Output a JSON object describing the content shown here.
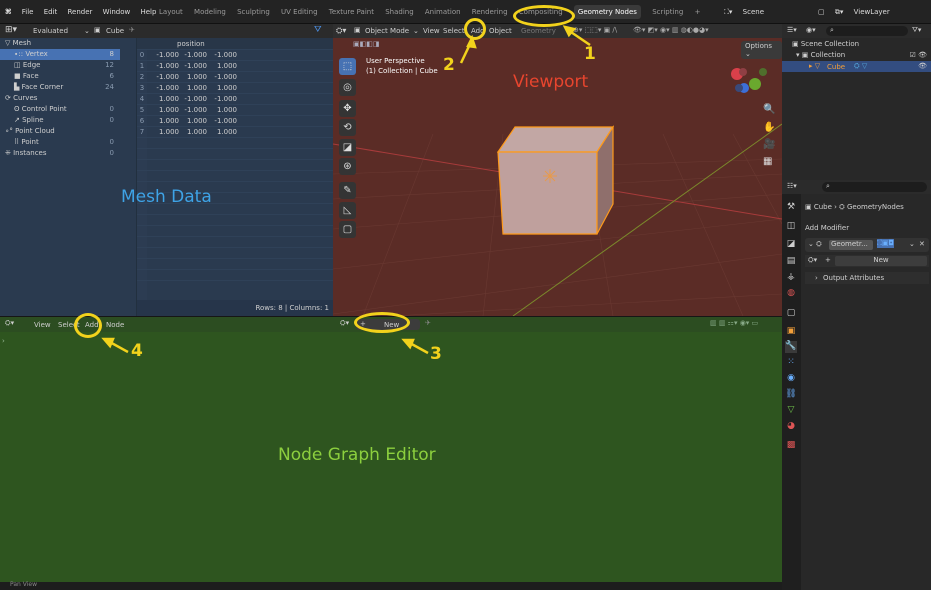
{
  "topbar": {
    "menus": [
      "File",
      "Edit",
      "Render",
      "Window",
      "Help"
    ],
    "workspaces": [
      "Layout",
      "Modeling",
      "Sculpting",
      "UV Editing",
      "Texture Paint",
      "Shading",
      "Animation",
      "Rendering",
      "Compositing",
      "Geometry Nodes",
      "Scripting",
      "+"
    ],
    "scene_label": "Scene",
    "viewlayer_label": "ViewLayer"
  },
  "spreadsheet": {
    "mode": "Evaluated",
    "object": "Cube",
    "column_header": "position",
    "tree": [
      {
        "label": "Mesh",
        "count": ""
      },
      {
        "label": "Vertex",
        "count": "8"
      },
      {
        "label": "Edge",
        "count": "12"
      },
      {
        "label": "Face",
        "count": "6"
      },
      {
        "label": "Face Corner",
        "count": "24"
      },
      {
        "label": "Curves",
        "count": ""
      },
      {
        "label": "Control Point",
        "count": "0"
      },
      {
        "label": "Spline",
        "count": "0"
      },
      {
        "label": "Point Cloud",
        "count": ""
      },
      {
        "label": "Point",
        "count": "0"
      },
      {
        "label": "Instances",
        "count": "0"
      }
    ],
    "rows": [
      [
        "0",
        "-1.000",
        "-1.000",
        "-1.000"
      ],
      [
        "1",
        "-1.000",
        "-1.000",
        "1.000"
      ],
      [
        "2",
        "-1.000",
        "1.000",
        "-1.000"
      ],
      [
        "3",
        "-1.000",
        "1.000",
        "1.000"
      ],
      [
        "4",
        "1.000",
        "-1.000",
        "-1.000"
      ],
      [
        "5",
        "1.000",
        "-1.000",
        "1.000"
      ],
      [
        "6",
        "1.000",
        "1.000",
        "-1.000"
      ],
      [
        "7",
        "1.000",
        "1.000",
        "1.000"
      ]
    ],
    "footer": "Rows: 8   |   Columns: 1",
    "overlay_label": "Mesh Data"
  },
  "viewport": {
    "mode": "Object Mode",
    "menus": [
      "View",
      "Select",
      "Add",
      "Object"
    ],
    "hidden_menu": "Geometry",
    "info_line1": "User Perspective",
    "info_line2": "(1) Collection | Cube",
    "options_label": "Options",
    "overlay_label": "Viewport"
  },
  "node_editor": {
    "menus": [
      "View",
      "Select",
      "Add",
      "Node"
    ],
    "new_label": "New",
    "overlay_label": "Node Graph Editor",
    "status_left": "Pan View"
  },
  "outliner": {
    "scene_collection": "Scene Collection",
    "collection": "Collection",
    "cube": "Cube"
  },
  "properties": {
    "breadcrumb_obj": "Cube",
    "breadcrumb_mod": "GeometryNodes",
    "add_modifier": "Add Modifier",
    "modifier_name": "Geometr...",
    "new_label": "New",
    "output_attributes": "Output Attributes"
  },
  "annotations": [
    "1",
    "2",
    "3",
    "4"
  ],
  "colors": {
    "annotation": "#f2d21c",
    "viewport_label": "#e8452e",
    "mesh_label": "#3ea3e6",
    "node_label": "#8ccf3e"
  }
}
